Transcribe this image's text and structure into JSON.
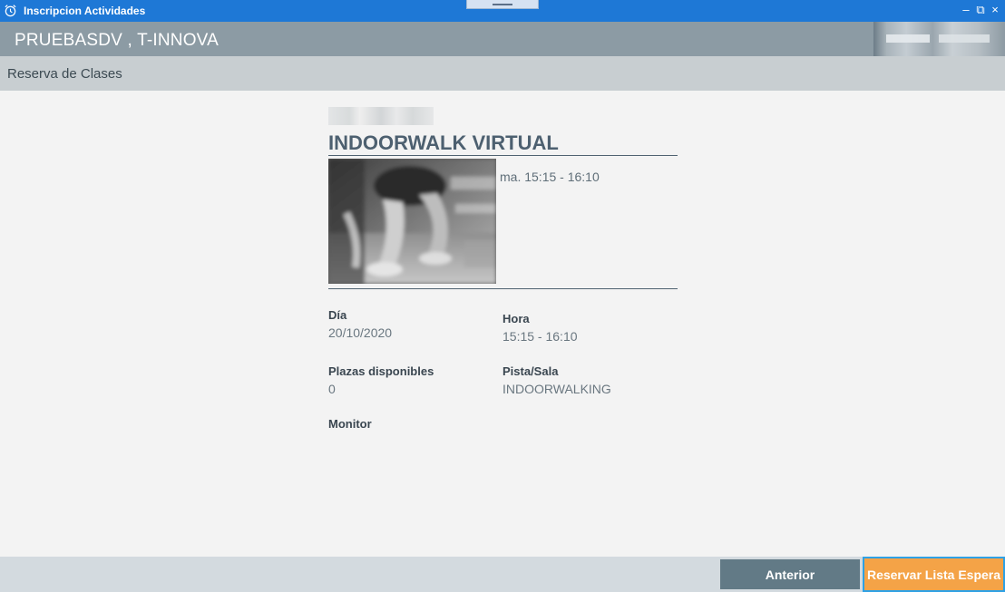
{
  "window": {
    "title": "Inscripcion Actividades",
    "controls": {
      "minimize": "–",
      "restore": "⧉",
      "close": "×"
    }
  },
  "header": {
    "user": "PRUEBASDV , T-INNOVA"
  },
  "subheader": {
    "section": "Reserva de Clases"
  },
  "activity": {
    "name": "INDOORWALK VIRTUAL",
    "schedule": "ma. 15:15 - 16:10",
    "image_icon": "fitness-photo"
  },
  "details": {
    "dia": {
      "label": "Día",
      "value": "20/10/2020"
    },
    "hora": {
      "label": "Hora",
      "value": "15:15 - 16:10"
    },
    "plazas": {
      "label": "Plazas disponibles",
      "value": "0"
    },
    "sala": {
      "label": "Pista/Sala",
      "value": "INDOORWALKING"
    },
    "monitor": {
      "label": "Monitor",
      "value": ""
    }
  },
  "footer": {
    "previous_label": "Anterior",
    "waitlist_label": "Reservar Lista Espera"
  },
  "colors": {
    "titlebar": "#1e78d6",
    "header": "#8c9ba4",
    "accent_orange": "#f4a347",
    "button_slate": "#627a86"
  }
}
